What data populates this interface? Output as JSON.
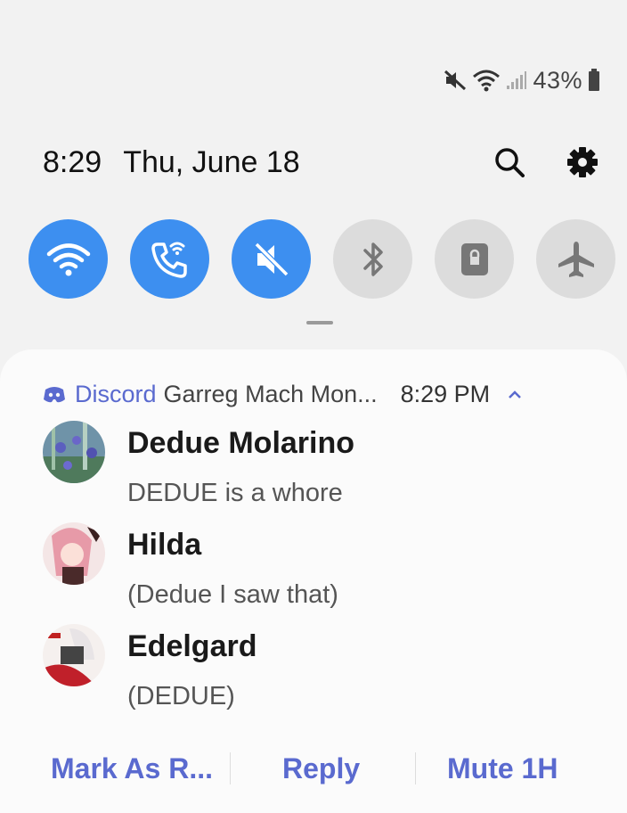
{
  "status_bar": {
    "icons": [
      "mute-icon",
      "wifi-icon",
      "signal-icon",
      "battery-icon"
    ],
    "battery_percent": "43%"
  },
  "header": {
    "time": "8:29",
    "date": "Thu, June 18",
    "icons": [
      "search-icon",
      "gear-icon"
    ]
  },
  "quick_settings": [
    {
      "name": "wifi",
      "icon": "wifi-icon",
      "active": true
    },
    {
      "name": "wifi-calling",
      "icon": "wifi-call-icon",
      "active": true
    },
    {
      "name": "mute",
      "icon": "mute-icon",
      "active": true
    },
    {
      "name": "bluetooth",
      "icon": "bluetooth-icon",
      "active": false
    },
    {
      "name": "rotation-lock",
      "icon": "lock-icon",
      "active": false
    },
    {
      "name": "airplane-mode",
      "icon": "airplane-icon",
      "active": false
    }
  ],
  "notification": {
    "app_name": "Discord",
    "channel": "Garreg Mach Mon...",
    "time": "8:29 PM",
    "messages": [
      {
        "sender": "Dedue Molarino",
        "text": "DEDUE is a whore"
      },
      {
        "sender": "Hilda",
        "text": "(Dedue I saw that)"
      },
      {
        "sender": "Edelgard",
        "text": "(DEDUE)"
      }
    ],
    "actions": [
      "Mark As R...",
      "Reply",
      "Mute 1H"
    ]
  },
  "colors": {
    "accent": "#3d8ff0",
    "discord_link": "#5a6acf",
    "background": "#f2f2f2",
    "card": "#fbfbfb"
  }
}
